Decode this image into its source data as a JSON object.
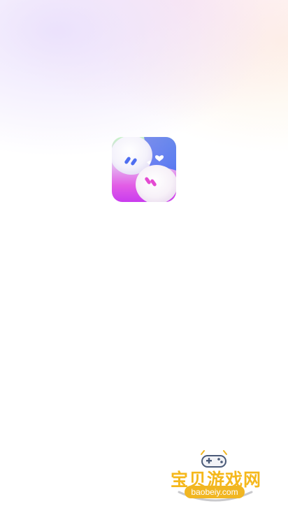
{
  "splash": {
    "app_icon": "twin-blob-chat-app-icon",
    "background": "white-with-pastel-glow"
  },
  "watermark": {
    "title": "宝贝游戏网",
    "domain": "baobeiy.com",
    "icon": "gamepad-icon",
    "colors": {
      "title": "#f5b81c",
      "pill": "#f1b622",
      "controller": "#4a5a78"
    }
  }
}
